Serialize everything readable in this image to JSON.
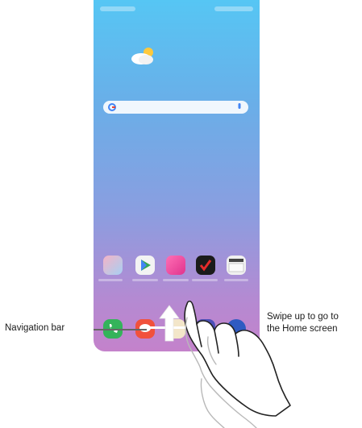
{
  "annotations": {
    "swipe_line1": "Swipe up to go to",
    "swipe_line2": "the Home screen",
    "navigation_bar": "Navigation bar"
  },
  "colors": {
    "wallpaper_top": "#56c6f4",
    "wallpaper_bottom": "#c482cb",
    "arrow": "#ffffff"
  },
  "icons": {
    "weather": "partly-cloudy-icon",
    "search_google": "google-icon",
    "search_mic": "mic-icon",
    "apps_row": [
      "gallery-icon",
      "play-store-icon",
      "qmemo-icon",
      "todo-icon",
      "more-apps-icon"
    ],
    "dock": [
      "phone-icon",
      "messages-icon",
      "camera-icon",
      "browser-icon",
      "internet-icon"
    ]
  }
}
